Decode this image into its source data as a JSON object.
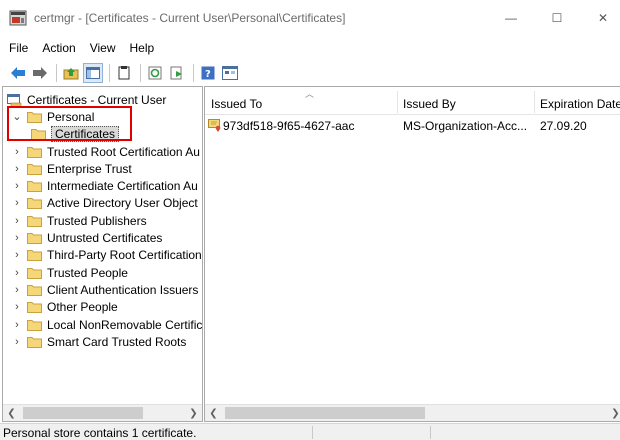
{
  "window": {
    "title": "certmgr - [Certificates - Current User\\Personal\\Certificates]",
    "minimize_glyph": "—",
    "maximize_glyph": "☐",
    "close_glyph": "✕"
  },
  "menu": [
    "File",
    "Action",
    "View",
    "Help"
  ],
  "toolbar": {
    "icons": [
      "back-arrow-icon",
      "forward-arrow-icon",
      "up-folder-icon",
      "show-hide-tree-icon",
      "properties-icon",
      "refresh-icon",
      "export-list-icon",
      "help-icon",
      "view-icon"
    ]
  },
  "tree": {
    "root": "Certificates - Current User",
    "expanded": "Personal",
    "selected": "Certificates",
    "items": [
      "Trusted Root Certification Au",
      "Enterprise Trust",
      "Intermediate Certification Au",
      "Active Directory User Object",
      "Trusted Publishers",
      "Untrusted Certificates",
      "Third-Party Root Certification",
      "Trusted People",
      "Client Authentication Issuers",
      "Other People",
      "Local NonRemovable Certific",
      "Smart Card Trusted Roots"
    ]
  },
  "list": {
    "columns": [
      "Issued To",
      "Issued By",
      "Expiration Date"
    ],
    "rows": [
      {
        "issued_to": "973df518-9f65-4627-aac",
        "issued_by": "MS-Organization-Acc...",
        "expiration": "27.09.20"
      }
    ]
  },
  "status": {
    "text": "Personal store contains 1 certificate."
  },
  "colors": {
    "highlight": "#e00000",
    "folder": "#f5d77a"
  }
}
